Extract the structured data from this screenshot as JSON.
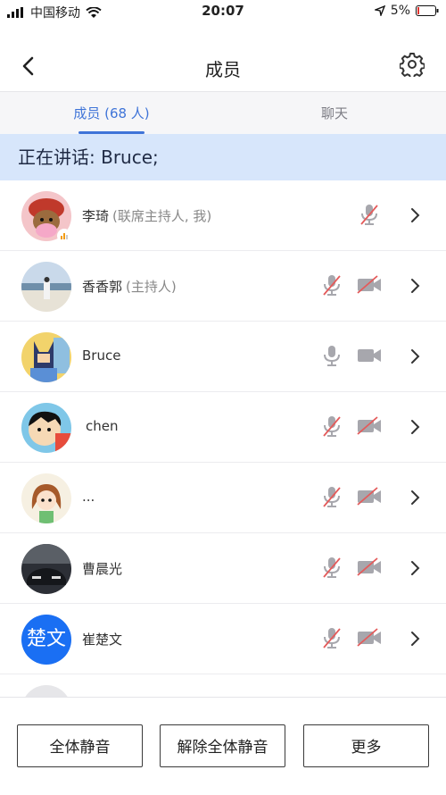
{
  "status_bar": {
    "carrier": "中国移动",
    "time": "20:07",
    "battery": "5%"
  },
  "header": {
    "title": "成员"
  },
  "tabs": [
    {
      "label": "成员 (68 人)"
    },
    {
      "label": "聊天"
    }
  ],
  "speaking": {
    "text": "正在讲话: Bruce;"
  },
  "members": [
    {
      "name": "李琦",
      "role": "(联席主持人, 我)",
      "avatar": "cartoon-character",
      "mic": "muted",
      "camera": "none"
    },
    {
      "name": "香香郭",
      "role": "(主持人)",
      "avatar": "beach-photo",
      "mic": "muted",
      "camera": "off"
    },
    {
      "name": "Bruce",
      "role": "",
      "avatar": "batman-cartoon",
      "mic": "on",
      "camera": "on"
    },
    {
      "name": "chen",
      "role": "",
      "avatar": "anime-character",
      "mic": "muted",
      "camera": "off"
    },
    {
      "name": "...",
      "role": "",
      "avatar": "cartoon-girl",
      "mic": "muted",
      "camera": "off"
    },
    {
      "name": "曹晨光",
      "role": "",
      "avatar": "car-photo",
      "mic": "muted",
      "camera": "off"
    },
    {
      "name": "崔楚文",
      "role": "",
      "avatar": "text-avatar",
      "avatar_text": "楚文",
      "mic": "muted",
      "camera": "off"
    }
  ],
  "buttons": {
    "mute_all": "全体静音",
    "unmute_all": "解除全体静音",
    "more": "更多"
  },
  "colors": {
    "accent": "#3f74d8",
    "speaking_bg": "#d7e6fb",
    "muted_red": "#e45b5b",
    "icon_gray": "#a7a7ad",
    "text_avatar_bg": "#1a6ff3"
  }
}
